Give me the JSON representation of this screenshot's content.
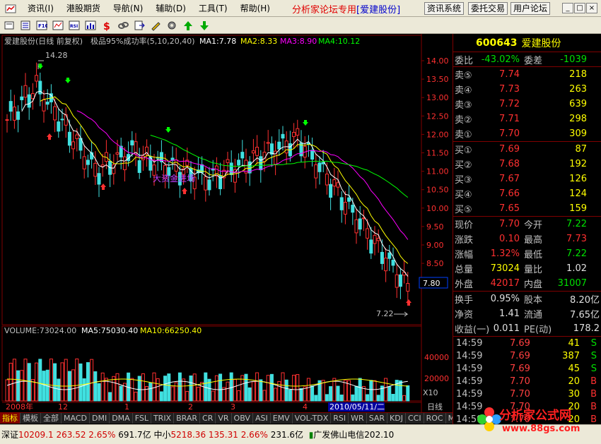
{
  "menu": {
    "items": [
      "资讯(I)",
      "港股期货",
      "导航(N)",
      "辅助(D)",
      "工具(T)",
      "帮助(H)"
    ],
    "forum_title_red": "分析家论坛专用",
    "forum_title_blue": "[爱建股份]",
    "buttons": [
      "资讯系统",
      "委托交易",
      "用户论坛"
    ]
  },
  "chart": {
    "header_name": "爱建股份(日线 前复权)",
    "header_indicator": "极品95%成功率(5,10,20,40)",
    "ma1": "MA1:7.78",
    "ma2": "MA2:8.33",
    "ma3": "MA3:8.90",
    "ma4": "MA4:10.12",
    "high_label": "14.28",
    "low_label": "7.22",
    "price_axis": [
      "14.00",
      "13.50",
      "13.00",
      "12.50",
      "12.00",
      "11.50",
      "11.00",
      "10.50",
      "10.00",
      "9.50",
      "9.00",
      "8.50",
      "8.00"
    ],
    "current_price_tag": "7.80",
    "watermark_text": "大资金进场",
    "volume_label": "VOLUME:73024.00",
    "vol_ma5": "MA5:75030.40",
    "vol_ma10": "MA10:66250.40",
    "vol_axis": [
      "40000",
      "20000"
    ],
    "vol_unit": "X10",
    "date_labels": [
      "2008年",
      "12",
      "1",
      "2",
      "3",
      "4"
    ],
    "date_highlight": "2010/05/11/二",
    "period": "日线",
    "colors": {
      "up": "#ff3030",
      "down": "#40e0e0",
      "ma1": "#ffffff",
      "ma2": "#ffff00",
      "ma3": "#ff00ff",
      "ma4": "#00ff00"
    }
  },
  "bottom_tabs": [
    "指标",
    "模板",
    "全部",
    "MACD",
    "DMI",
    "DMA",
    "FSL",
    "TRIX",
    "BRAR",
    "CR",
    "VR",
    "OBV",
    "ASI",
    "EMV",
    "VOL-TDX",
    "RSI",
    "WR",
    "SAR",
    "KDJ",
    "CCI",
    "ROC",
    "MTM"
  ],
  "statusbar": {
    "sz_label": "深证",
    "sz_value": "10209.1",
    "sz_change": "263.52",
    "sz_pct": "2.65%",
    "sz_amount": "691.7亿",
    "zx_label": "中小",
    "zx_value": "5218.36",
    "zx_change": "135.31",
    "zx_pct": "2.66%",
    "zx_amount": "231.6亿",
    "broker": "广发佛山电信202.10"
  },
  "stock": {
    "code": "600643",
    "name": "爱建股份",
    "weibi_label": "委比",
    "weibi": "-43.02%",
    "weicha_label": "委差",
    "weicha": "-1039",
    "sells": [
      {
        "label": "卖⑤",
        "price": "7.74",
        "vol": "218"
      },
      {
        "label": "卖④",
        "price": "7.73",
        "vol": "263"
      },
      {
        "label": "卖③",
        "price": "7.72",
        "vol": "639"
      },
      {
        "label": "卖②",
        "price": "7.71",
        "vol": "298"
      },
      {
        "label": "卖①",
        "price": "7.70",
        "vol": "309"
      }
    ],
    "buys": [
      {
        "label": "买①",
        "price": "7.69",
        "vol": "87"
      },
      {
        "label": "买②",
        "price": "7.68",
        "vol": "192"
      },
      {
        "label": "买③",
        "price": "7.67",
        "vol": "126"
      },
      {
        "label": "买④",
        "price": "7.66",
        "vol": "124"
      },
      {
        "label": "买⑤",
        "price": "7.65",
        "vol": "159"
      }
    ],
    "quote": [
      {
        "l1": "现价",
        "v1": "7.70",
        "c1": "red",
        "l2": "今开",
        "v2": "7.22",
        "c2": "green"
      },
      {
        "l1": "涨跌",
        "v1": "0.10",
        "c1": "red",
        "l2": "最高",
        "v2": "7.73",
        "c2": "red"
      },
      {
        "l1": "涨幅",
        "v1": "1.32%",
        "c1": "red",
        "l2": "最低",
        "v2": "7.22",
        "c2": "green"
      },
      {
        "l1": "总量",
        "v1": "73024",
        "c1": "yellow",
        "l2": "量比",
        "v2": "1.02",
        "c2": "white"
      },
      {
        "l1": "外盘",
        "v1": "42017",
        "c1": "red",
        "l2": "内盘",
        "v2": "31007",
        "c2": "green"
      }
    ],
    "fund": [
      {
        "l1": "换手",
        "v1": "0.95%",
        "l2": "股本",
        "v2": "8.20亿"
      },
      {
        "l1": "净资",
        "v1": "1.41",
        "l2": "流通",
        "v2": "7.65亿"
      },
      {
        "l1": "收益(一)",
        "v1": "0.011",
        "l2": "PE(动)",
        "v2": "178.2"
      }
    ],
    "ticks": [
      {
        "time": "14:59",
        "price": "7.69",
        "vol": "41",
        "bs": "S"
      },
      {
        "time": "14:59",
        "price": "7.69",
        "vol": "387",
        "bs": "S"
      },
      {
        "time": "14:59",
        "price": "7.69",
        "vol": "45",
        "bs": "S"
      },
      {
        "time": "14:59",
        "price": "7.70",
        "vol": "20",
        "bs": "B"
      },
      {
        "time": "14:59",
        "price": "7.70",
        "vol": "30",
        "bs": "B"
      },
      {
        "time": "14:59",
        "price": "7.70",
        "vol": "20",
        "bs": "B"
      },
      {
        "time": "14:59",
        "price": "7.70",
        "vol": "20",
        "bs": "B"
      }
    ]
  },
  "watermark": {
    "text": "分析家公式网",
    "url": "www.88gs.com"
  }
}
